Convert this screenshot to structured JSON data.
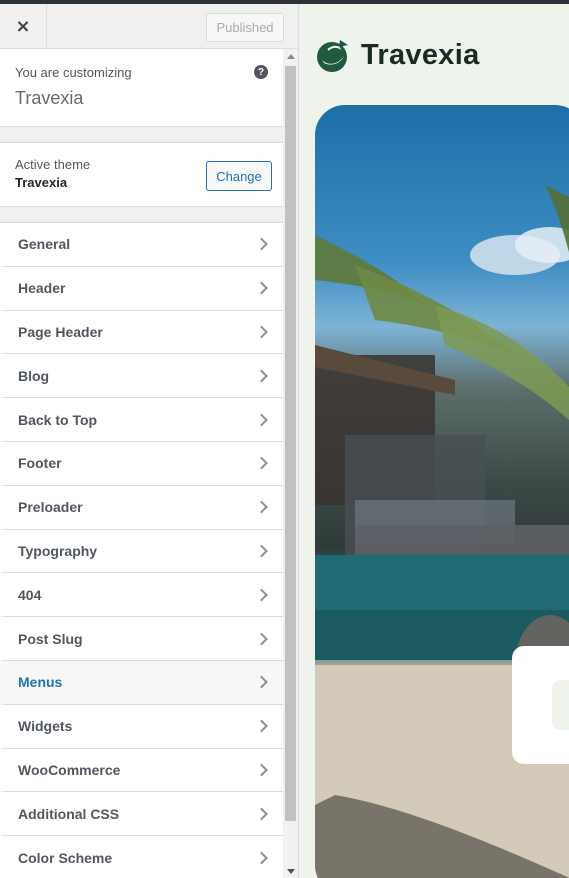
{
  "header": {
    "close_label": "×",
    "publish_label": "Published"
  },
  "info": {
    "small_label": "You are customizing",
    "site_title": "Travexia",
    "help_glyph": "?"
  },
  "theme": {
    "small_label": "Active theme",
    "name": "Travexia",
    "change_label": "Change"
  },
  "menu": {
    "items": [
      {
        "label": "General"
      },
      {
        "label": "Header"
      },
      {
        "label": "Page Header"
      },
      {
        "label": "Blog"
      },
      {
        "label": "Back to Top"
      },
      {
        "label": "Footer"
      },
      {
        "label": "Preloader"
      },
      {
        "label": "Typography"
      },
      {
        "label": "404"
      },
      {
        "label": "Post Slug"
      },
      {
        "label": "Menus"
      },
      {
        "label": "Widgets"
      },
      {
        "label": "WooCommerce"
      },
      {
        "label": "Additional CSS"
      },
      {
        "label": "Color Scheme"
      }
    ],
    "active_item": "Menus"
  },
  "preview": {
    "logo_text": "Travexia"
  },
  "colors": {
    "accent": "#2271b1",
    "logo_green": "#1f5a3c",
    "preview_bg": "#eef3ec"
  }
}
